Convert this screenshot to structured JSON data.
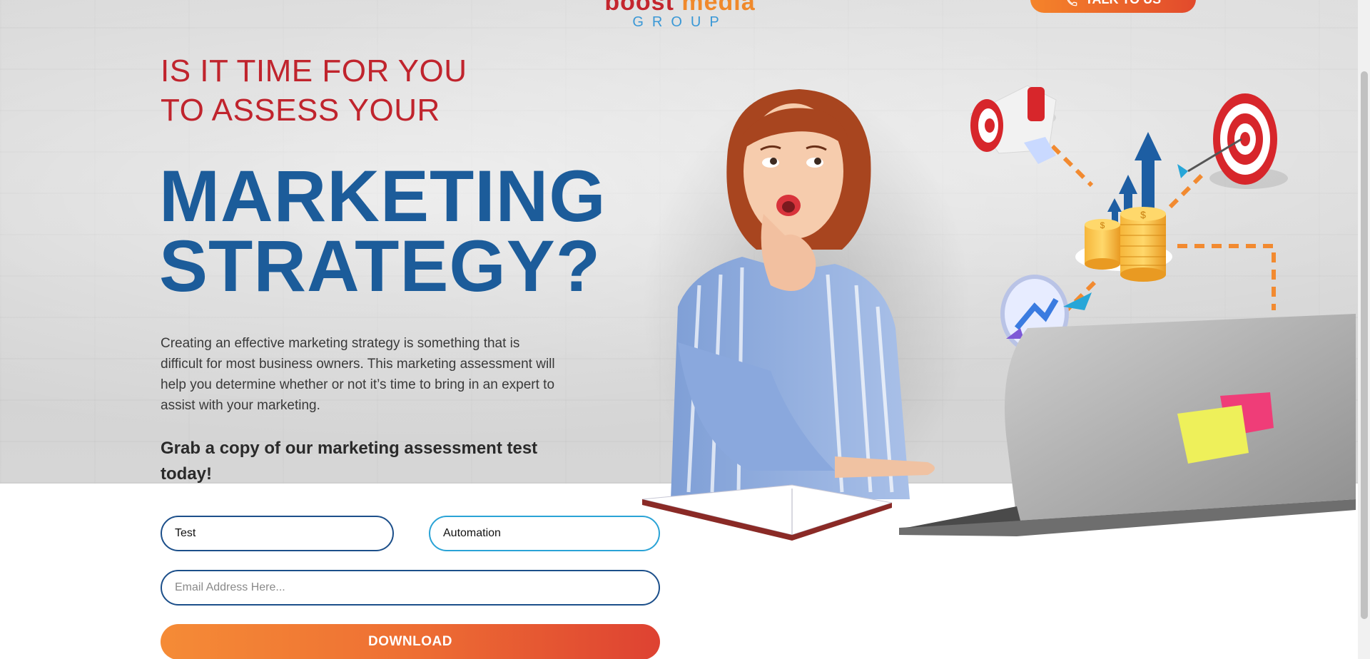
{
  "logo": {
    "word_left": "boost",
    "word_right": "media",
    "group": "GROUP"
  },
  "header": {
    "cta_label": "TALK TO US"
  },
  "hero": {
    "subhead_line1": "IS IT TIME FOR YOU",
    "subhead_line2": "TO ASSESS YOUR",
    "headline_line1": "MARKETING",
    "headline_line2": "STRATEGY?",
    "body": "Creating an effective marketing strategy is something that is difficult for most business owners. This marketing assessment will help you determine whether or not it’s time to bring in an expert to assist with your marketing.",
    "grab": "Grab a copy of our marketing assessment test today!"
  },
  "form": {
    "first_name_value": "Test",
    "last_name_value": "Automation",
    "email_placeholder": "Email Address Here...",
    "email_value": "",
    "download_label": "DOWNLOAD"
  },
  "icons": {
    "phone": "phone-icon",
    "megaphone": "megaphone-icon",
    "target": "target-icon",
    "coins": "coins-icon",
    "growth_arrows": "growth-arrows-icon",
    "magnifier": "magnifier-icon",
    "laptop": "laptop-icon",
    "notebook": "notebook-icon"
  },
  "colors": {
    "accent_red": "#c0242d",
    "accent_blue": "#1c5c9a",
    "button_orange": "#f58b36",
    "button_red": "#de4232",
    "field_border": "#1c4f8a",
    "field_focus_border": "#2aa3d6"
  }
}
